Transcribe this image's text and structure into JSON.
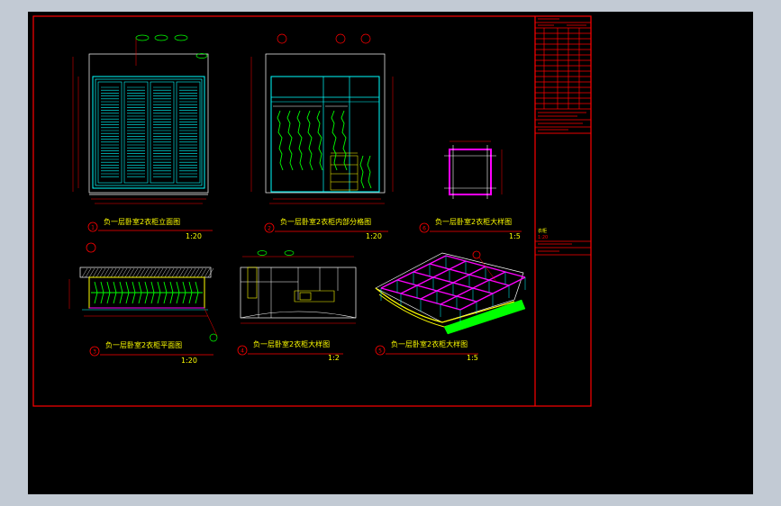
{
  "colors": {
    "viewport_bg": "#000000",
    "frame": "#ff0000",
    "cyan": "#00ffff",
    "yellow": "#ffff00",
    "green": "#00ff00",
    "magenta": "#ff00ff",
    "white": "#ffffff"
  },
  "views": [
    {
      "number": "1",
      "title": "负一层卧室2衣柜立面图",
      "scale": "1:20"
    },
    {
      "number": "2",
      "title": "负一层卧室2衣柜内部分格图",
      "scale": "1:20"
    },
    {
      "number": "6",
      "title": "负一层卧室2衣柜大样图",
      "scale": "1:5"
    },
    {
      "number": "3",
      "title": "负一层卧室2衣柜平面图",
      "scale": "1:20"
    },
    {
      "number": "4",
      "title": "负一层卧室2衣柜大样图",
      "scale": "1:2"
    },
    {
      "number": "5",
      "title": "负一层卧室2衣柜大样图",
      "scale": "1:5"
    }
  ],
  "title_block": {
    "drawing_name": "衣柜",
    "scale_note": "1:20"
  }
}
